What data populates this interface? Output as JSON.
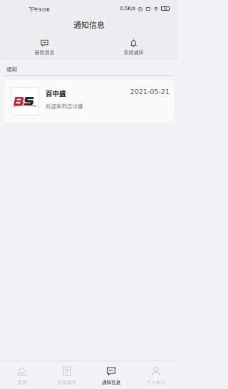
{
  "status_bar": {
    "time": "下午3:06",
    "network_speed": "0.5K/s",
    "battery": "76"
  },
  "title": "通知信息",
  "top_tabs": [
    {
      "label": "最新消息",
      "icon": "chat-icon"
    },
    {
      "label": "系统通知",
      "icon": "bell-icon"
    }
  ],
  "section_label": "通知",
  "messages": [
    {
      "sender": "百中盛",
      "date": "2021-05-21",
      "preview": "欢迎来到百中盛",
      "avatar_text": "BS"
    }
  ],
  "bottom_nav": [
    {
      "label": "首页",
      "icon": "home-icon",
      "active": false
    },
    {
      "label": "信息填写",
      "icon": "form-icon",
      "active": false
    },
    {
      "label": "通知信息",
      "icon": "message-icon",
      "active": true
    },
    {
      "label": "个人中心",
      "icon": "user-icon",
      "active": false
    }
  ],
  "colors": {
    "background": "#f3f3f5",
    "header": "#ededf0",
    "card": "#fafafb",
    "logo_red": "#c8202a",
    "logo_dark": "#2a2a2a"
  }
}
